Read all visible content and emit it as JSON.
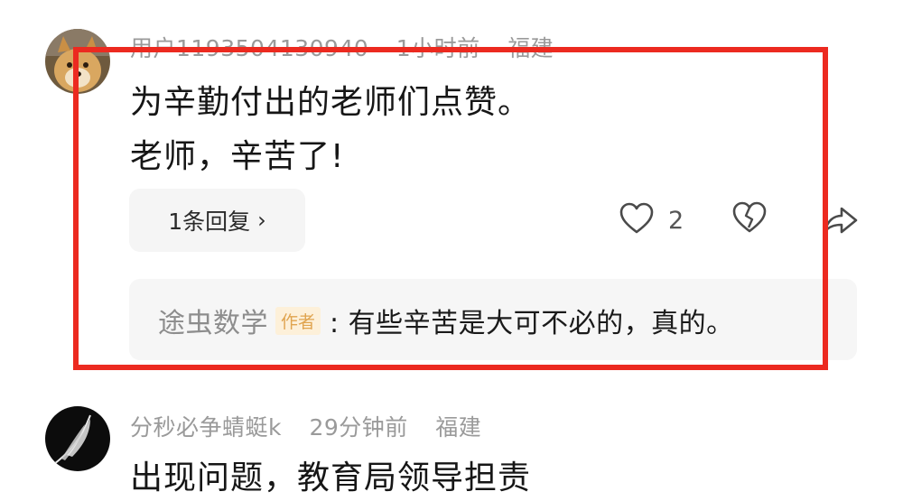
{
  "comments": [
    {
      "username": "用户119350413094​0",
      "time": "1小时前",
      "location": "福建",
      "lines": [
        "为辛勤付出的老师们点赞。",
        "老师，辛苦了!"
      ],
      "reply_count_label": "1条回复",
      "reply_chevron": "›",
      "like_count": "2",
      "author_reply": {
        "author": "途虫数学",
        "badge": "作者",
        "text": ": 有些辛苦是大可不必的，真的。"
      }
    },
    {
      "username": "分秒必争蜻蜓k",
      "time": "29分钟前",
      "location": "福建",
      "lines": [
        "出现问题，教育局领导担责"
      ]
    }
  ],
  "icons": {
    "like": "heart-outline-icon",
    "dislike": "broken-heart-icon",
    "share": "share-arrow-icon"
  },
  "colors": {
    "highlight_border": "#ec2a20",
    "meta_text": "#9a9a9a",
    "badge_bg": "#fdf0d9",
    "badge_text": "#e0a44f"
  }
}
